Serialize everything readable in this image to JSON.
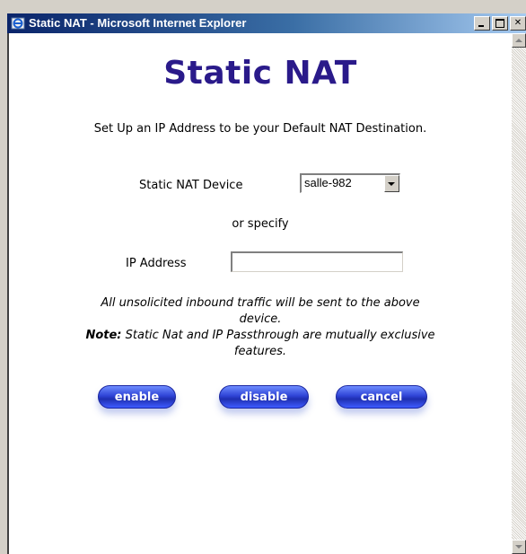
{
  "window": {
    "title": "Static NAT - Microsoft Internet Explorer",
    "icon": "ie-icon",
    "controls": [
      "minimize-icon",
      "maximize-icon",
      "close-icon"
    ]
  },
  "page": {
    "heading": "Static NAT",
    "intro": "Set Up an IP Address to be your Default NAT Destination.",
    "device_label": "Static NAT Device",
    "device_value": "salle-982",
    "or_specify": "or specify",
    "ip_label": "IP Address",
    "ip_value": "",
    "note_line": "All unsolicited inbound traffic will be sent to the above device.",
    "note_label": "Note:",
    "note_text": "Static Nat and IP Passthrough are mutually exclusive features."
  },
  "buttons": {
    "enable": "enable",
    "disable": "disable",
    "cancel": "cancel"
  },
  "colors": {
    "heading": "#2a1a8a",
    "titlebar_start": "#0a246a",
    "button_blue": "#2f44d6"
  }
}
